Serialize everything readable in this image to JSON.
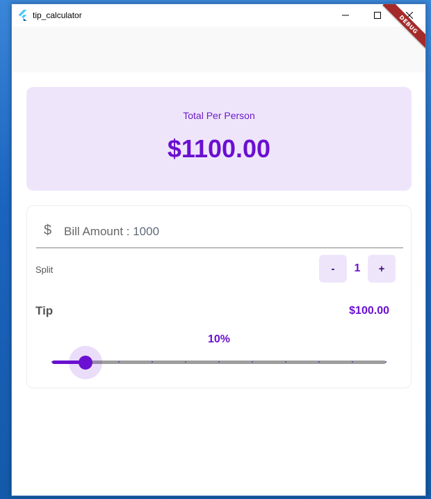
{
  "window": {
    "title": "tip_calculator",
    "debug_banner": "DEBUG"
  },
  "colors": {
    "accent": "#6a10d1",
    "card_bg": "#efe5fb",
    "debug_banner": "#a52a2a"
  },
  "total_card": {
    "label": "Total Per Person",
    "value": "$1100.00"
  },
  "bill": {
    "icon": "dollar-icon",
    "icon_glyph": "$",
    "label": "Bill Amount : ",
    "value": "1000"
  },
  "split": {
    "label": "Split",
    "minus_label": "-",
    "plus_label": "+",
    "count": "1"
  },
  "tip": {
    "label": "Tip",
    "amount": "$100.00",
    "percent_text": "10%",
    "slider": {
      "min": 0,
      "max": 100,
      "divisions": 10,
      "value": 10
    }
  }
}
